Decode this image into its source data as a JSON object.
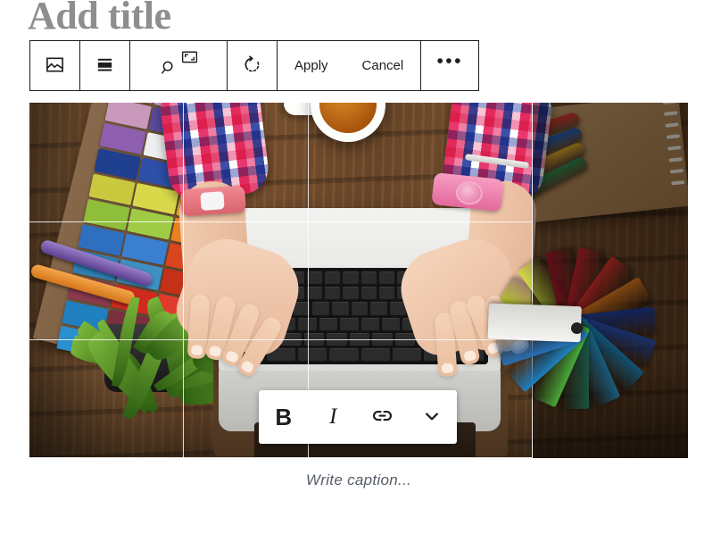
{
  "editor": {
    "post_title_placeholder": "Add title"
  },
  "block_toolbar": {
    "buttons": [
      {
        "name": "image-block-type",
        "icon": "image-icon",
        "label": "Image"
      },
      {
        "name": "align-button",
        "icon": "align-center-icon",
        "label": "Change alignment"
      },
      {
        "name": "crop-button",
        "icon": "zoom-icon",
        "icon2": "aspect-ratio-icon",
        "label": "Crop"
      },
      {
        "name": "rotate-button",
        "icon": "rotate-icon",
        "label": "Rotate"
      }
    ],
    "apply_label": "Apply",
    "cancel_label": "Cancel",
    "more_label": "•••"
  },
  "format_toolbar": {
    "bold_label": "B",
    "italic_label": "I",
    "link_label": "link-icon",
    "more_label": "chevron-down-icon"
  },
  "caption": {
    "placeholder": "Write caption..."
  },
  "image": {
    "alt": "Overhead photo of hands typing on a white laptop on a wooden desk surrounded by color swatch fans, markers, a spiral notebook, a cup of coffee and a potted plant",
    "crop_mode": true
  },
  "colors": {
    "title_gray": "#8e8e8e",
    "toolbar_border": "#1e1e1e",
    "caption_gray": "#555d66",
    "toolbar_bg": "#ffffff",
    "grid_white": "rgba(255,255,255,0.82)"
  },
  "swatch_strip_colors": [
    "#c85b86",
    "#b8a7c9",
    "#9e7fb8",
    "#c999bb",
    "#5b4a9e",
    "#6a5bb5",
    "#8e5fae",
    "#efeff1",
    "#4a3f9b",
    "#1f3f8f",
    "#2e4fa8",
    "#2b5fb5",
    "#c9c93f",
    "#d8d84a",
    "#e0a32a",
    "#8fbf3a",
    "#9fcb45",
    "#e8811f",
    "#2f6fc0",
    "#3a7fd0",
    "#d9451f",
    "#2e7fb5",
    "#3f8fc5",
    "#c43018",
    "#8b3a4f",
    "#d02a1f",
    "#e23a2a",
    "#1f7fbf",
    "#7a2f3f",
    "#e0452f",
    "#2a8fcf",
    "#2f6f9f",
    "#d8504a"
  ],
  "fan_blade_colors": [
    "#b5c130",
    "#cfd93f",
    "#a8182a",
    "#c8242e",
    "#d8322a",
    "#e07a1f",
    "#1f3f9f",
    "#2a52b5",
    "#1f8fc5",
    "#2a9fd5",
    "#2f8f6f",
    "#4aa83a",
    "#1f7fbf",
    "#2a6fb5"
  ],
  "marker_colors": [
    "#d8342a",
    "#1f5fc0",
    "#e0a82a",
    "#2a8f4f"
  ]
}
